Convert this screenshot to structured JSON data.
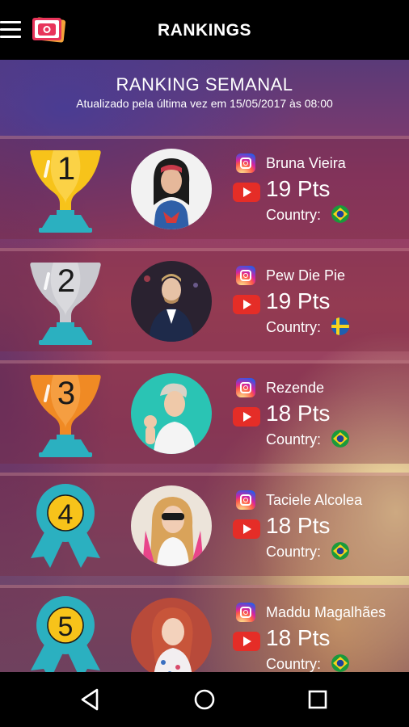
{
  "topbar": {
    "title": "RANKINGS",
    "menu_icon": "hamburger-menu-icon",
    "logo_icon": "camera-app-logo-icon"
  },
  "header": {
    "title": "RANKING SEMANAL",
    "subtitle": "Atualizado pela última vez em 15/05/2017 às 08:00"
  },
  "rankings": [
    {
      "rank": "1",
      "badge": "gold-trophy-icon",
      "name": "Bruna Vieira",
      "points": "19 Pts",
      "country_label": "Country:",
      "flag": "brazil-flag-icon"
    },
    {
      "rank": "2",
      "badge": "silver-trophy-icon",
      "name": "Pew Die Pie",
      "points": "19 Pts",
      "country_label": "Country:",
      "flag": "sweden-flag-icon"
    },
    {
      "rank": "3",
      "badge": "bronze-trophy-icon",
      "name": "Rezende",
      "points": "18 Pts",
      "country_label": "Country:",
      "flag": "brazil-flag-icon"
    },
    {
      "rank": "4",
      "badge": "ribbon-medal-icon",
      "name": "Taciele Alcolea",
      "points": "18 Pts",
      "country_label": "Country:",
      "flag": "brazil-flag-icon"
    },
    {
      "rank": "5",
      "badge": "ribbon-medal-icon",
      "name": "Maddu Magalhães",
      "points": "18 Pts",
      "country_label": "Country:",
      "flag": "brazil-flag-icon"
    }
  ],
  "colors": {
    "gold": "#f7c31a",
    "silver": "#c9c9cf",
    "bronze": "#f08a24",
    "teal": "#2bb0c0",
    "youtube": "#e52d27"
  },
  "navbar": {
    "back_icon": "back-triangle-icon",
    "home_icon": "home-circle-icon",
    "recents_icon": "recents-square-icon"
  }
}
